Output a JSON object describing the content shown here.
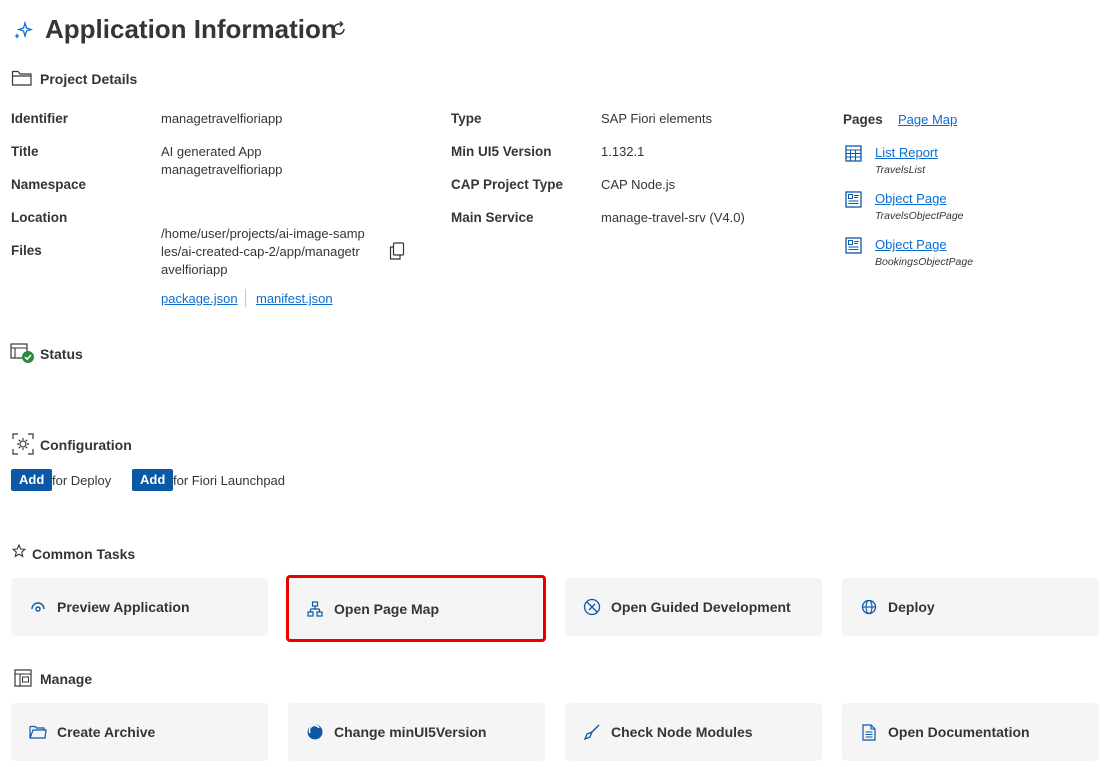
{
  "header": {
    "title": "Application Information"
  },
  "project_details": {
    "heading": "Project Details",
    "left": [
      {
        "key": "Identifier",
        "value": "managetravelfioriapp"
      },
      {
        "key": "Title",
        "value": "AI generated App managetravelfioriapp"
      },
      {
        "key": "Namespace",
        "value": ""
      },
      {
        "key": "Location",
        "value": ""
      },
      {
        "key": "Files",
        "value": "/home/user/projects/ai-image-samples/ai-created-cap-2/app/managetravelfioriapp"
      }
    ],
    "file_links": [
      "package.json",
      "manifest.json"
    ],
    "middle": [
      {
        "key": "Type",
        "value": "SAP Fiori elements"
      },
      {
        "key": "Min UI5 Version",
        "value": "1.132.1"
      },
      {
        "key": "CAP Project Type",
        "value": "CAP Node.js"
      },
      {
        "key": "Main Service",
        "value": "manage-travel-srv (V4.0)"
      }
    ],
    "pages": {
      "label": "Pages",
      "page_map_link": "Page Map",
      "items": [
        {
          "title": "List Report",
          "sub": "TravelsList",
          "icon": "table-icon"
        },
        {
          "title": "Object Page",
          "sub": "TravelsObjectPage",
          "icon": "object-page-icon"
        },
        {
          "title": "Object Page",
          "sub": "BookingsObjectPage",
          "icon": "object-page-icon"
        }
      ]
    }
  },
  "status": {
    "heading": "Status"
  },
  "configuration": {
    "heading": "Configuration",
    "items": [
      {
        "button": "Add",
        "text": "for Deploy"
      },
      {
        "button": "Add",
        "text": "for Fiori Launchpad"
      }
    ]
  },
  "common_tasks": {
    "heading": "Common Tasks",
    "tiles": [
      {
        "label": "Preview Application",
        "icon": "preview-icon"
      },
      {
        "label": "Open Page Map",
        "icon": "page-map-icon",
        "highlighted": true
      },
      {
        "label": "Open Guided Development",
        "icon": "guided-development-icon"
      },
      {
        "label": "Deploy",
        "icon": "globe-icon"
      }
    ]
  },
  "manage": {
    "heading": "Manage",
    "tiles": [
      {
        "label": "Create Archive",
        "icon": "folder-icon"
      },
      {
        "label": "Change minUI5Version",
        "icon": "ui5-icon"
      },
      {
        "label": "Check Node Modules",
        "icon": "broom-icon"
      },
      {
        "label": "Open Documentation",
        "icon": "document-icon"
      }
    ]
  },
  "colors": {
    "link": "#0a6ed1",
    "button": "#0a58a6",
    "highlight": "#e60000",
    "tile_bg": "#f5f5f5",
    "status_ok": "#2b8a3e"
  }
}
